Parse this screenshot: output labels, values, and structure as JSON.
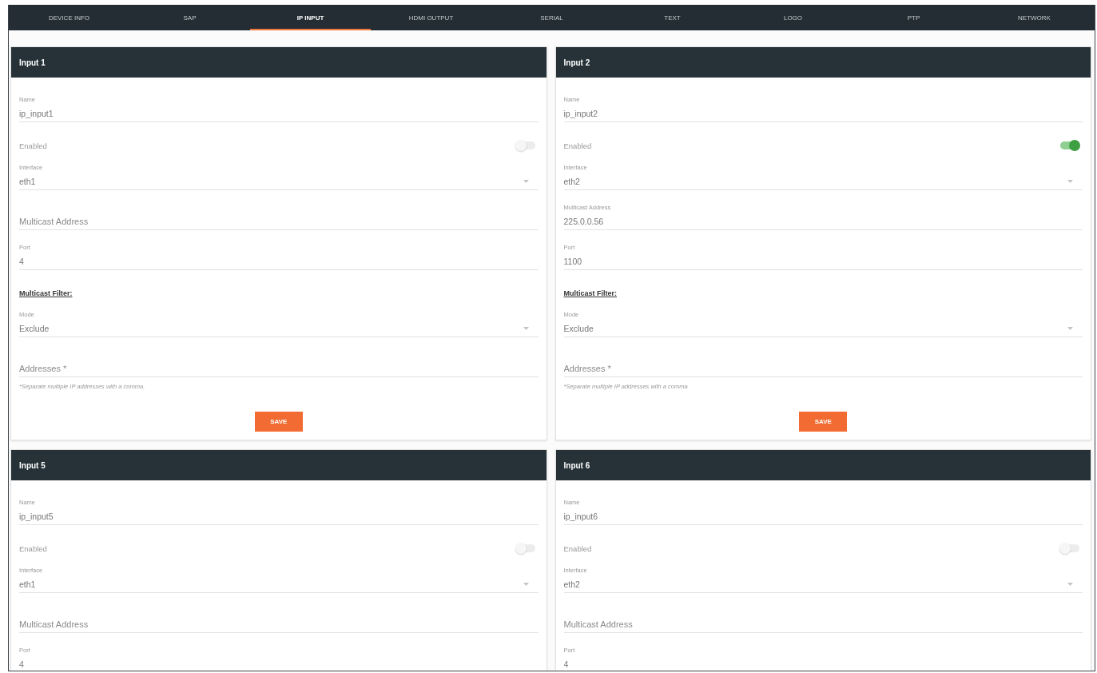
{
  "tabs": [
    {
      "label": "DEVICE INFO",
      "selected": false
    },
    {
      "label": "SAP",
      "selected": false
    },
    {
      "label": "IP INPUT",
      "selected": true
    },
    {
      "label": "HDMI OUTPUT",
      "selected": false
    },
    {
      "label": "SERIAL",
      "selected": false
    },
    {
      "label": "TEXT",
      "selected": false
    },
    {
      "label": "LOGO",
      "selected": false
    },
    {
      "label": "PTP",
      "selected": false
    },
    {
      "label": "NETWORK",
      "selected": false
    }
  ],
  "inputs": [
    {
      "title": "Input 1",
      "fields": [
        {
          "kind": "text",
          "label": "Name",
          "value": "ip_input1"
        },
        {
          "kind": "toggle",
          "label": "Enabled",
          "on": false
        },
        {
          "kind": "select",
          "label": "Interface",
          "value": "eth1"
        },
        {
          "kind": "text",
          "placeholder": "Multicast Address"
        },
        {
          "kind": "text",
          "label": "Port",
          "value": "4"
        },
        {
          "kind": "heading",
          "text": "Multicast Filter:"
        },
        {
          "kind": "select",
          "label": "Mode",
          "value": "Exclude"
        },
        {
          "kind": "text",
          "placeholder": "Addresses *",
          "helper_text": "*Separate multiple IP addresses with a comma."
        }
      ],
      "button": "SAVE"
    },
    {
      "title": "Input 2",
      "fields": [
        {
          "kind": "text",
          "label": "Name",
          "value": "ip_input2"
        },
        {
          "kind": "toggle",
          "label": "Enabled",
          "on": true
        },
        {
          "kind": "select",
          "label": "Interface",
          "value": "eth2"
        },
        {
          "kind": "text",
          "label": "Multicast Address",
          "value": "225.0.0.56"
        },
        {
          "kind": "text",
          "label": "Port",
          "value": "1100"
        },
        {
          "kind": "heading",
          "text": "Multicast Filter:"
        },
        {
          "kind": "select",
          "label": "Mode",
          "value": "Exclude"
        },
        {
          "kind": "text",
          "placeholder": "Addresses *",
          "helper_text": "*Separate multiple IP addresses with a comma"
        }
      ],
      "button": "SAVE"
    },
    {
      "title": "Input 5",
      "fields": [
        {
          "kind": "text",
          "label": "Name",
          "value": "ip_input5"
        },
        {
          "kind": "toggle",
          "label": "Enabled",
          "on": false
        },
        {
          "kind": "select",
          "label": "Interface",
          "value": "eth1"
        },
        {
          "kind": "text",
          "placeholder": "Multicast Address"
        },
        {
          "kind": "text",
          "label": "Port",
          "value": "4"
        }
      ]
    },
    {
      "title": "Input 6",
      "fields": [
        {
          "kind": "text",
          "label": "Name",
          "value": "ip_input6"
        },
        {
          "kind": "toggle",
          "label": "Enabled",
          "on": false
        },
        {
          "kind": "select",
          "label": "Interface",
          "value": "eth2"
        },
        {
          "kind": "text",
          "placeholder": "Multicast Address"
        },
        {
          "kind": "text",
          "label": "Port",
          "value": "4"
        }
      ]
    }
  ]
}
